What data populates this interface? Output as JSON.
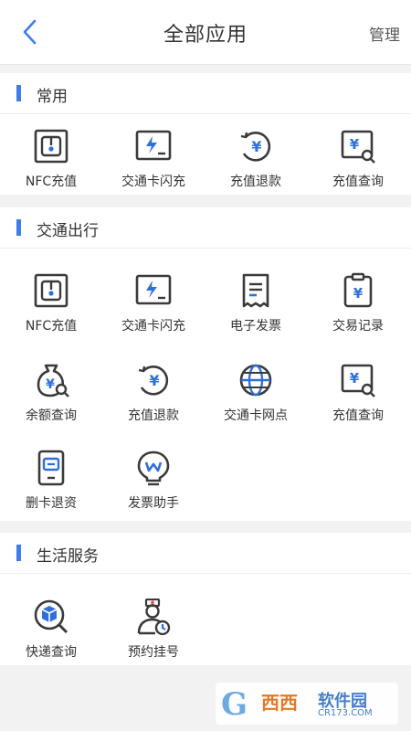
{
  "header": {
    "title": "全部应用",
    "manage": "管理"
  },
  "colors": {
    "accent": "#3d7de8",
    "icon_dark": "#3a3a3a",
    "icon_blue": "#2f6fdc"
  },
  "sections": [
    {
      "title": "常用",
      "items": [
        {
          "label": "NFC充值",
          "icon": "nfc-icon"
        },
        {
          "label": "交通卡闪充",
          "icon": "flash-charge-icon"
        },
        {
          "label": "充值退款",
          "icon": "refund-icon"
        },
        {
          "label": "充值查询",
          "icon": "recharge-query-icon"
        }
      ]
    },
    {
      "title": "交通出行",
      "items": [
        {
          "label": "NFC充值",
          "icon": "nfc-icon"
        },
        {
          "label": "交通卡闪充",
          "icon": "flash-charge-icon"
        },
        {
          "label": "电子发票",
          "icon": "invoice-icon"
        },
        {
          "label": "交易记录",
          "icon": "transaction-record-icon"
        },
        {
          "label": "余额查询",
          "icon": "balance-query-icon"
        },
        {
          "label": "充值退款",
          "icon": "refund-icon"
        },
        {
          "label": "交通卡网点",
          "icon": "globe-icon"
        },
        {
          "label": "充值查询",
          "icon": "recharge-query-icon"
        },
        {
          "label": "删卡退资",
          "icon": "delete-card-icon"
        },
        {
          "label": "发票助手",
          "icon": "invoice-assistant-icon"
        }
      ]
    },
    {
      "title": "生活服务",
      "items": [
        {
          "label": "快递查询",
          "icon": "express-query-icon"
        },
        {
          "label": "预约挂号",
          "icon": "appointment-icon"
        }
      ]
    }
  ],
  "watermark": {
    "line1": "西西",
    "line2": "软件园",
    "line3": "CR173.COM"
  }
}
